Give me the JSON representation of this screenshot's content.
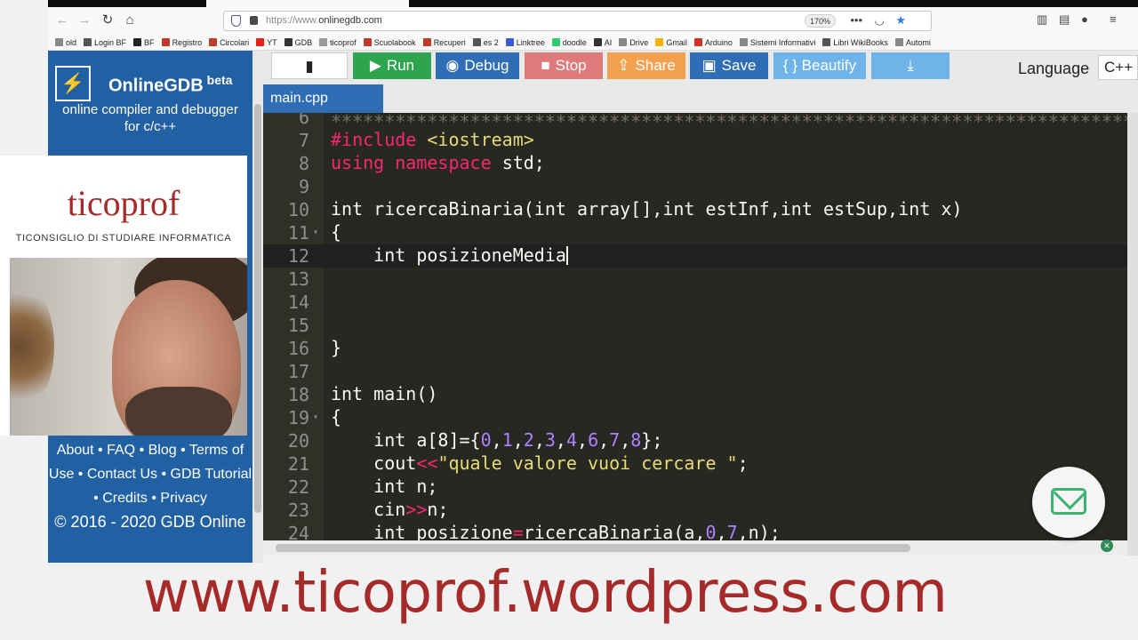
{
  "browser": {
    "url_prefix": "https://www.",
    "url_domain": "onlinegdb.com",
    "zoom": "170%",
    "bookmarks": [
      "old",
      "Login BF",
      "BF",
      "Registro",
      "Circolari",
      "YT",
      "GDB",
      "ticoprof",
      "Scuolabook",
      "Recuperi",
      "es 2",
      "Linktree",
      "doodle",
      "AI",
      "Drive",
      "Gmail",
      "Arduino",
      "Sistemi Informativi",
      "Libri WikiBooks",
      "Automi"
    ],
    "bookmark_colors": [
      "#888888",
      "#555555",
      "#222222",
      "#c0392b",
      "#c0392b",
      "#e62117",
      "#333333",
      "#999999",
      "#c0392b",
      "#c0392b",
      "#555555",
      "#3b5bdb",
      "#2ecc71",
      "#333333",
      "#888888",
      "#f4b400",
      "#d93025",
      "#888888",
      "#555555",
      "#888888"
    ]
  },
  "sidebar": {
    "brand_title": "OnlineGDB",
    "brand_beta": "beta",
    "brand_tagline_1": "online compiler and debugger",
    "brand_tagline_2": "for c/c++",
    "links": {
      "about": "About",
      "faq": "FAQ",
      "blog": "Blog",
      "terms": "Terms of Use",
      "contact": "Contact Us",
      "tutorial": "GDB Tutorial",
      "credits": "Credits",
      "privacy": "Privacy",
      "copyright": "© 2016 - 2020 GDB Online"
    }
  },
  "overlay": {
    "title": "ticoprof",
    "subtitle": "TICONSIGLIO DI STUDIARE INFORMATICA"
  },
  "toolbar": {
    "run": "Run",
    "debug": "Debug",
    "stop": "Stop",
    "share": "Share",
    "save": "Save",
    "beautify": "{ } Beautify",
    "language_label": "Language",
    "language_value": "C++"
  },
  "editor": {
    "file_tab": "main.cpp",
    "lines": [
      {
        "n": "6",
        "fold": ""
      },
      {
        "n": "7",
        "fold": ""
      },
      {
        "n": "8",
        "fold": ""
      },
      {
        "n": "9",
        "fold": ""
      },
      {
        "n": "10",
        "fold": ""
      },
      {
        "n": "11",
        "fold": "▾"
      },
      {
        "n": "12",
        "fold": ""
      },
      {
        "n": "13",
        "fold": ""
      },
      {
        "n": "14",
        "fold": ""
      },
      {
        "n": "15",
        "fold": ""
      },
      {
        "n": "16",
        "fold": ""
      },
      {
        "n": "17",
        "fold": ""
      },
      {
        "n": "18",
        "fold": ""
      },
      {
        "n": "19",
        "fold": "▾"
      },
      {
        "n": "20",
        "fold": ""
      },
      {
        "n": "21",
        "fold": ""
      },
      {
        "n": "22",
        "fold": ""
      },
      {
        "n": "23",
        "fold": ""
      },
      {
        "n": "24",
        "fold": ""
      }
    ],
    "stars": "*******************************************************************************************",
    "code": {
      "include_kw": "#include",
      "include_lib": "<iostream>",
      "using": "using",
      "namespace": "namespace",
      "std": "std;",
      "func_sig_int": "int",
      "func_name": "ricercaBinaria(",
      "func_params_a": "int",
      "func_params_b": "array[],",
      "func_params_c": "int",
      "func_params_d": "estInf,",
      "func_params_e": "int",
      "func_params_f": "estSup,",
      "func_params_g": "int",
      "func_params_h": "x)",
      "open_brace": "{",
      "close_brace": "}",
      "pos_media_type": "int",
      "pos_media_name": "posizioneMedia",
      "main_int": "int",
      "main_name": "main()",
      "arr_type": "int",
      "arr_decl": "a[8]={",
      "arr_vals": [
        "0",
        "1",
        "2",
        "3",
        "4",
        "6",
        "7",
        "8"
      ],
      "arr_end": "};",
      "cout": "cout",
      "cout_op": "<<",
      "cout_str": "\"quale valore vuoi cercare \"",
      "semi": ";",
      "n_type": "int",
      "n_decl": "n;",
      "cin": "cin",
      "cin_op": ">>",
      "cin_rest": "n;",
      "pos_type": "int",
      "pos_name": "posizione",
      "pos_eq": "=",
      "pos_call": "ricercaBinaria(a,",
      "pos_zero": "0",
      "pos_comma": ",",
      "pos_seven": "7",
      "pos_end": ",n);"
    }
  },
  "footer": {
    "url": "www.ticoprof.wordpress.com"
  }
}
